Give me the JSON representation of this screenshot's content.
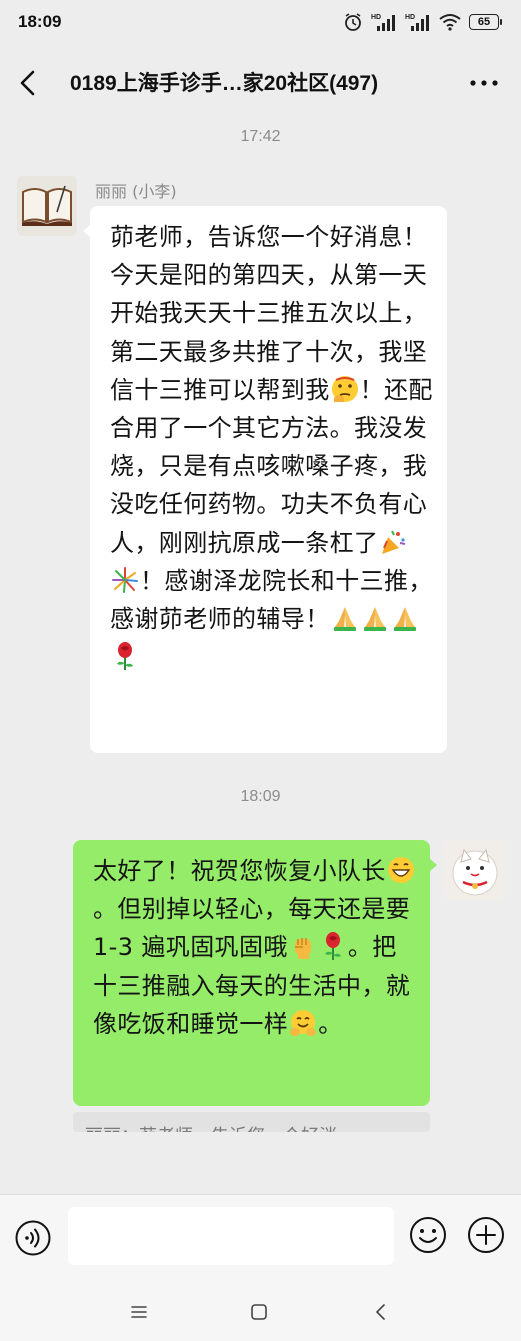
{
  "status_bar": {
    "time": "18:09",
    "battery": "65",
    "network_labels": [
      "HD",
      "HD"
    ]
  },
  "header": {
    "title": "0189上海手诊手…家20社区(497)",
    "back_icon": "chevron-left-icon",
    "more_icon": "more-dots-icon"
  },
  "messages": [
    {
      "timestamp": "17:42",
      "sender": "丽丽 (小李)",
      "direction": "incoming",
      "segments": [
        {
          "t": "text",
          "v": "茆老师，告诉您一个好消息！今天是阳的第四天，从第一天开始我天天十三推五次以上，第二天最多共推了十次，我坚信十三推可以帮到我"
        },
        {
          "t": "emoji",
          "v": "thinking-face-emoji"
        },
        {
          "t": "text",
          "v": "！还配合用了一个其它方法。我没发烧，只是有点咳嗽嗓子疼，我没吃任何药物。功夫不负有心人，刚刚抗原成一条杠了"
        },
        {
          "t": "emoji",
          "v": "party-popper-emoji"
        },
        {
          "t": "emoji",
          "v": "fireworks-emoji"
        },
        {
          "t": "text",
          "v": "！感谢泽龙院长和十三推，感谢茆老师的辅导！"
        },
        {
          "t": "emoji",
          "v": "folded-hands-emoji"
        },
        {
          "t": "emoji",
          "v": "folded-hands-emoji"
        },
        {
          "t": "emoji",
          "v": "folded-hands-emoji"
        },
        {
          "t": "emoji",
          "v": "rose-emoji"
        }
      ]
    },
    {
      "timestamp": "18:09",
      "direction": "outgoing",
      "segments": [
        {
          "t": "text",
          "v": "太好了！祝贺您恢复小队长"
        },
        {
          "t": "emoji",
          "v": "grin-emoji"
        },
        {
          "t": "text",
          "v": "。但别掉以轻心，每天还是要 1-3 遍巩固巩固哦"
        },
        {
          "t": "emoji",
          "v": "fist-emoji"
        },
        {
          "t": "emoji",
          "v": "rose-emoji"
        },
        {
          "t": "text",
          "v": "。把十三推融入每天的生活中，就像吃饭和睡觉一样"
        },
        {
          "t": "emoji",
          "v": "hug-face-emoji"
        },
        {
          "t": "text",
          "v": "。"
        }
      ],
      "quote": "丽丽：茆老师，告诉您一个好消"
    }
  ],
  "input_bar": {
    "placeholder": "",
    "voice_icon": "voice-icon",
    "emoji_icon": "emoji-icon",
    "plus_icon": "plus-icon"
  },
  "nav_bar": {
    "icons": [
      "menu-icon",
      "home-icon",
      "back-icon"
    ]
  },
  "colors": {
    "background": "#ededed",
    "outgoing_bubble": "#95ec69",
    "incoming_bubble": "#ffffff"
  }
}
